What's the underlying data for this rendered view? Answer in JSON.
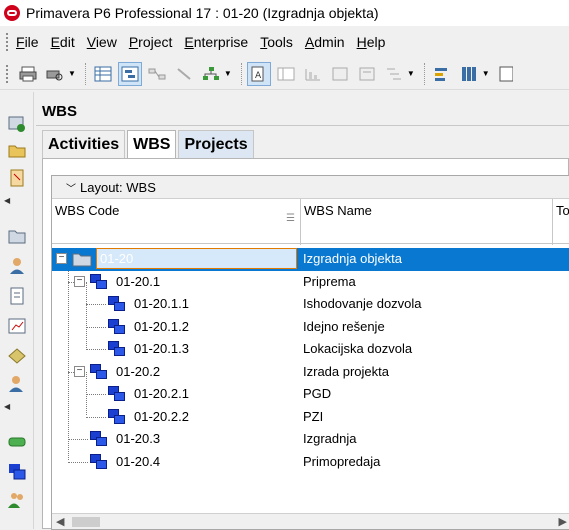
{
  "window": {
    "title": "Primavera P6 Professional 17 : 01-20 (Izgradnja objekta)"
  },
  "menu": {
    "items": [
      {
        "accel": "F",
        "rest": "ile"
      },
      {
        "accel": "E",
        "rest": "dit"
      },
      {
        "accel": "V",
        "rest": "iew"
      },
      {
        "accel": "P",
        "rest": "roject"
      },
      {
        "accel": "E",
        "rest": "nterprise"
      },
      {
        "accel": "T",
        "rest": "ools"
      },
      {
        "accel": "A",
        "rest": "dmin"
      },
      {
        "accel": "H",
        "rest": "elp"
      }
    ]
  },
  "panel": {
    "header": "WBS"
  },
  "tabs": [
    "Activities",
    "WBS",
    "Projects"
  ],
  "layout_label": "Layout: WBS",
  "columns": {
    "code": "WBS Code",
    "name": "WBS Name",
    "third": "To"
  },
  "rows": [
    {
      "code": "01-20",
      "name": "Izgradnja objekta"
    },
    {
      "code": "01-20.1",
      "name": "Priprema"
    },
    {
      "code": "01-20.1.1",
      "name": "Ishodovanje dozvola"
    },
    {
      "code": "01-20.1.2",
      "name": "Idejno rešenje"
    },
    {
      "code": "01-20.1.3",
      "name": "Lokacijska dozvola"
    },
    {
      "code": "01-20.2",
      "name": "Izrada projekta"
    },
    {
      "code": "01-20.2.1",
      "name": "PGD"
    },
    {
      "code": "01-20.2.2",
      "name": "PZI"
    },
    {
      "code": "01-20.3",
      "name": "Izgradnja"
    },
    {
      "code": "01-20.4",
      "name": "Primopredaja"
    }
  ],
  "colors": {
    "selection": "#0878d1",
    "wbs_icon": "#1a3fd1",
    "focus_border": "#e07b00"
  }
}
